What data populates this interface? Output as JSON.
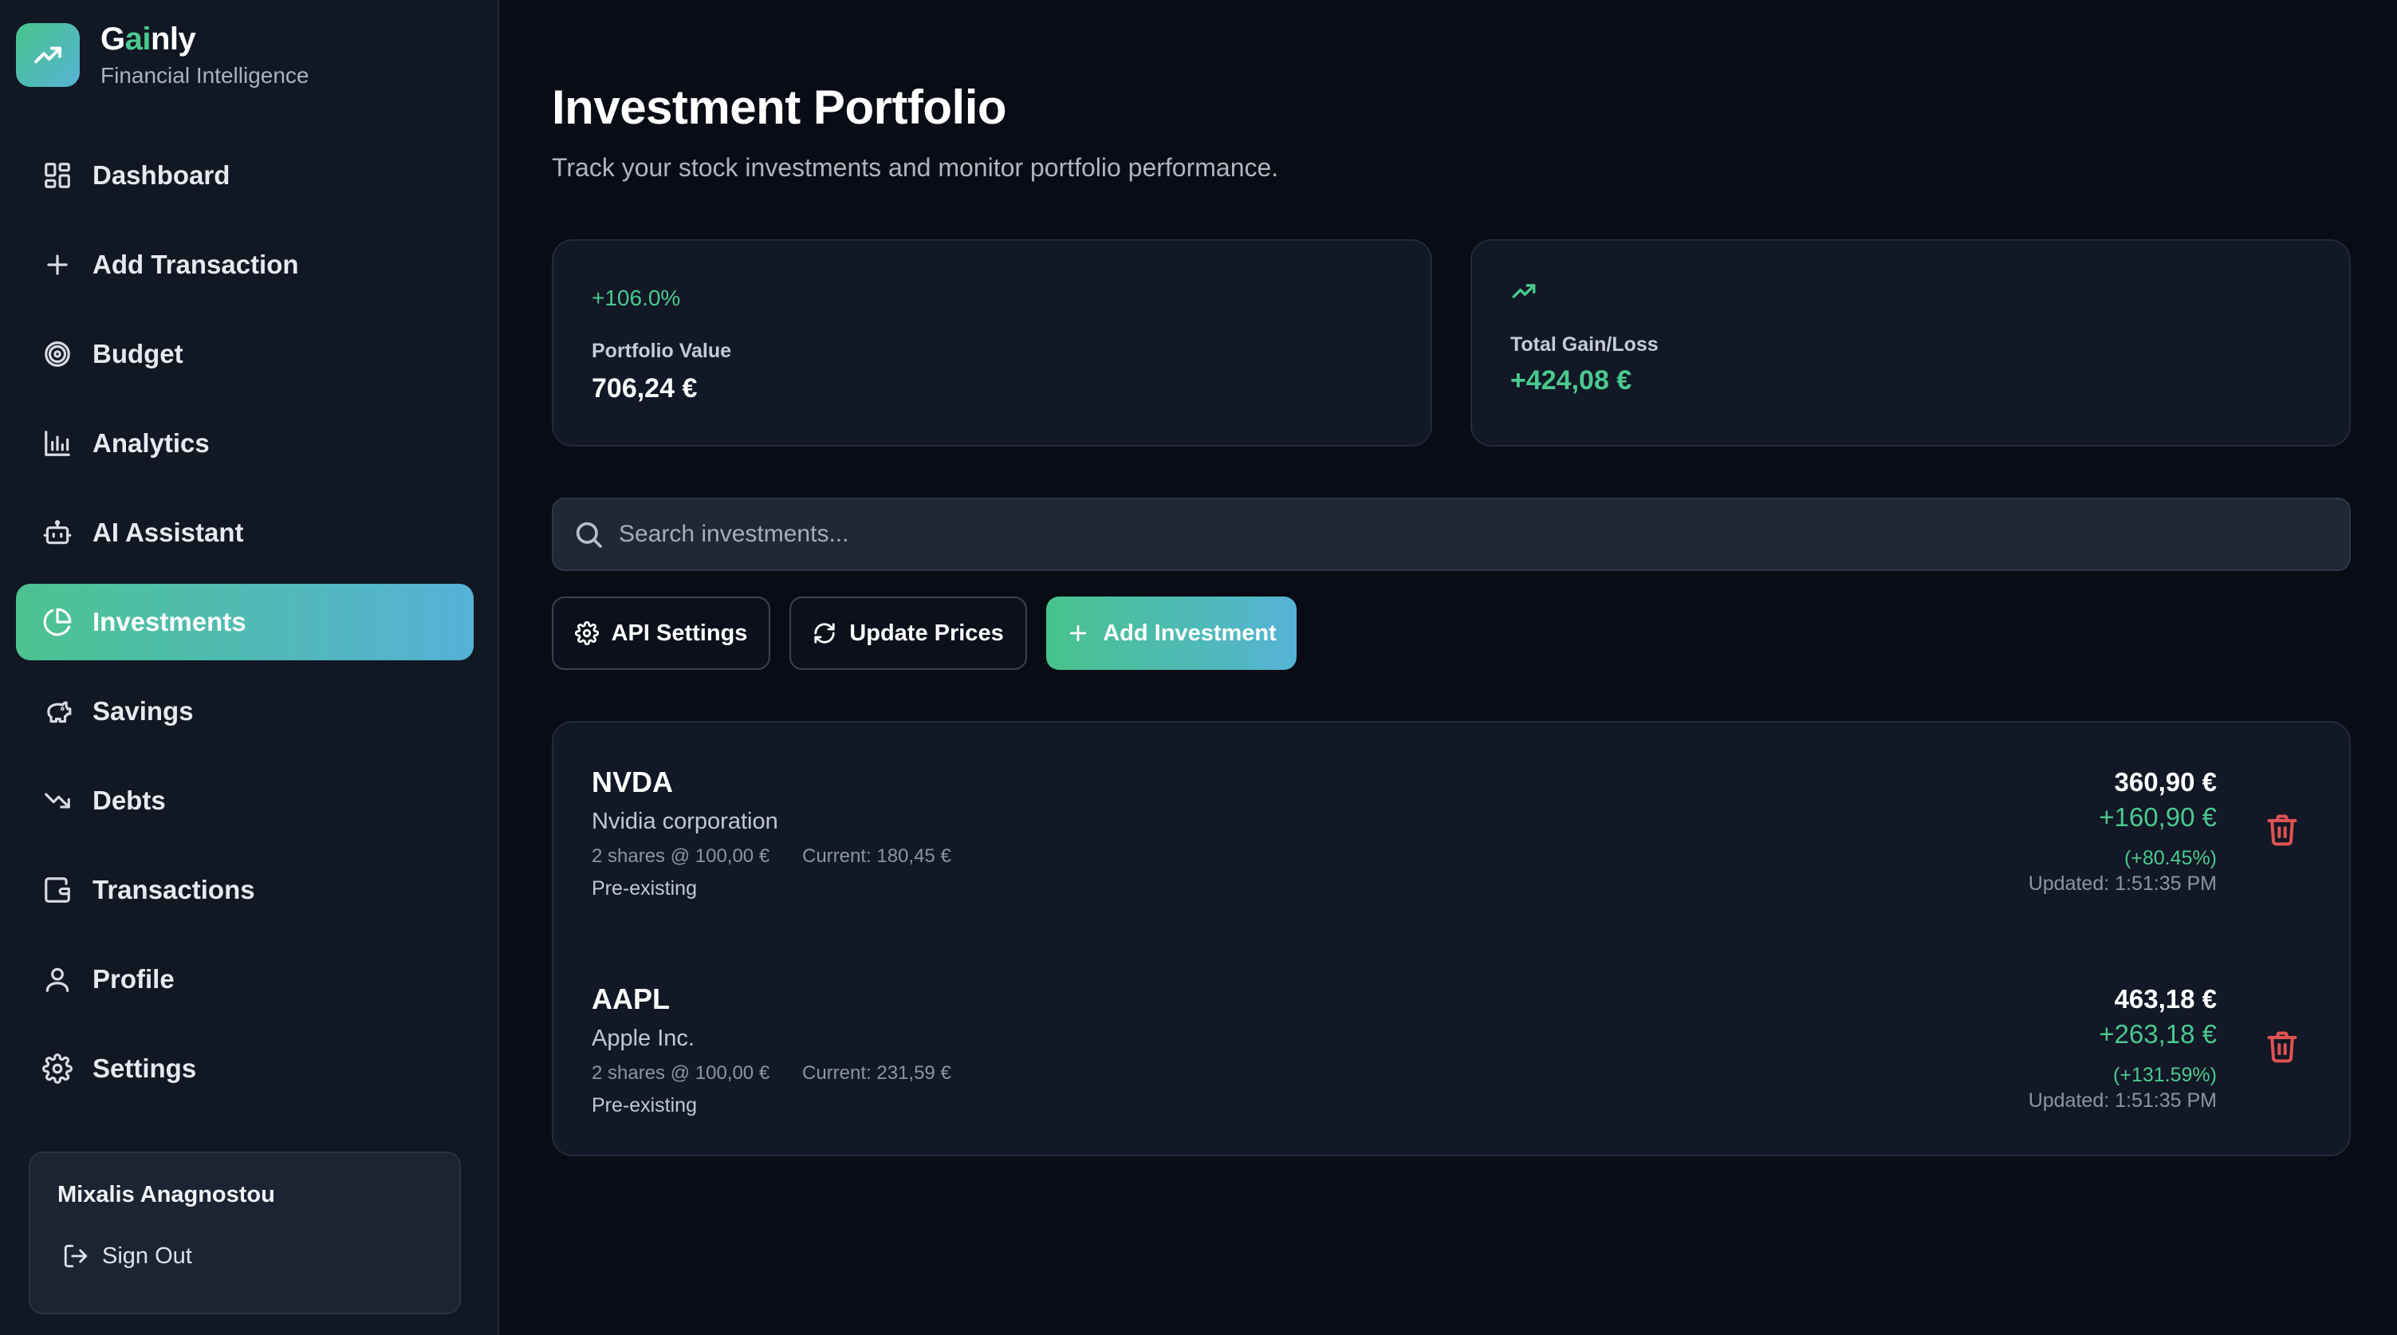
{
  "brand": {
    "name_part1": "G",
    "name_part2": "ai",
    "name_part3": "nly",
    "subtitle": "Financial Intelligence",
    "accent": "#4ac98e"
  },
  "sidebar": {
    "items": [
      {
        "label": "Dashboard",
        "icon": "layout-dashboard-icon",
        "active": false
      },
      {
        "label": "Add Transaction",
        "icon": "plus-icon",
        "active": false
      },
      {
        "label": "Budget",
        "icon": "target-icon",
        "active": false
      },
      {
        "label": "Analytics",
        "icon": "bar-chart-icon",
        "active": false
      },
      {
        "label": "AI Assistant",
        "icon": "bot-icon",
        "active": false
      },
      {
        "label": "Investments",
        "icon": "pie-chart-icon",
        "active": true
      },
      {
        "label": "Savings",
        "icon": "piggy-bank-icon",
        "active": false
      },
      {
        "label": "Debts",
        "icon": "trending-down-icon",
        "active": false
      },
      {
        "label": "Transactions",
        "icon": "wallet-icon",
        "active": false
      },
      {
        "label": "Profile",
        "icon": "user-icon",
        "active": false
      },
      {
        "label": "Settings",
        "icon": "gear-icon",
        "active": false
      }
    ],
    "user": {
      "name": "Mixalis Anagnostou",
      "sign_out": "Sign Out"
    }
  },
  "main": {
    "title": "Investment Portfolio",
    "subtitle": "Track your stock investments and monitor portfolio performance.",
    "portfolio_card": {
      "change": "+106.0%",
      "label": "Portfolio Value",
      "value": "706,24 €"
    },
    "gain_card": {
      "label": "Total Gain/Loss",
      "value": "+424,08 €"
    },
    "search": {
      "placeholder": "Search investments...",
      "value": ""
    },
    "buttons": {
      "api_settings": "API Settings",
      "update_prices": "Update Prices",
      "add_investment": "Add Investment"
    },
    "holdings": [
      {
        "symbol": "NVDA",
        "name": "Nvidia corporation",
        "shares": "2 shares @ 100,00 €",
        "current": "Current: 180,45 €",
        "tag": "Pre-existing",
        "value": "360,90 €",
        "gain": "+160,90 €",
        "gain_pct": "(+80.45%)",
        "updated": "Updated: 1:51:35 PM"
      },
      {
        "symbol": "AAPL",
        "name": "Apple Inc.",
        "shares": "2 shares @ 100,00 €",
        "current": "Current: 231,59 €",
        "tag": "Pre-existing",
        "value": "463,18 €",
        "gain": "+263,18 €",
        "gain_pct": "(+131.59%)",
        "updated": "Updated: 1:51:35 PM"
      }
    ]
  },
  "colors": {
    "positive": "#4ac98e",
    "danger": "#e05252",
    "background": "#090c14",
    "sidebar": "#111723"
  }
}
